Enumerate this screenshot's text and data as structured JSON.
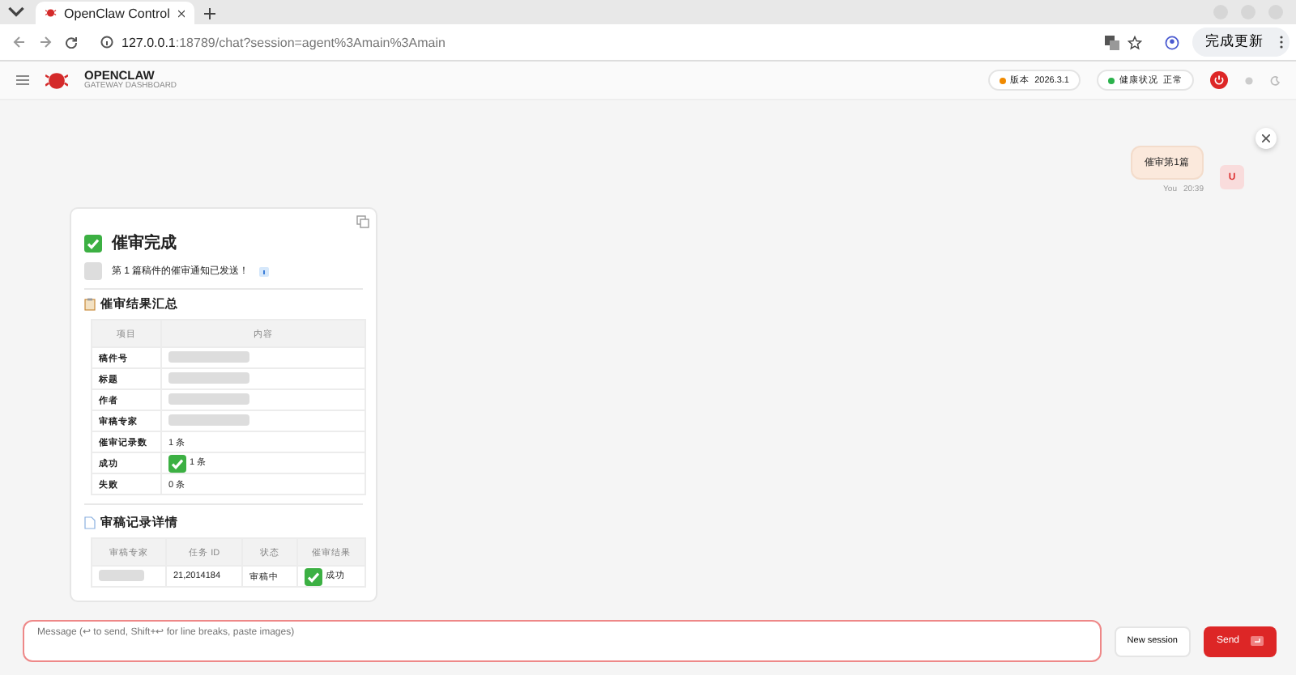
{
  "browser": {
    "tabs": [
      {
        "title": "OpenClaw Control",
        "selected": true
      }
    ],
    "url_host": "127.0.0.1",
    "url_rest": ":18789/chat?session=agent%3Amain%3Amain",
    "update_button": "完成更新"
  },
  "header": {
    "brand": "OPENCLAW",
    "subtitle": "GATEWAY DASHBOARD",
    "version_label": "版本",
    "version": "2026.3.1",
    "health_label": "健康状况",
    "health": "正常"
  },
  "user_message": {
    "text": "催审第1篇",
    "avatar": "U",
    "sender": "You",
    "time": "20:39"
  },
  "reply": {
    "title": "催审完成",
    "notice": "第 1 篇稿件的催审通知已发送！",
    "summary_title": "催审结果汇总",
    "summary_columns": [
      "项目",
      "内容"
    ],
    "summary_rows": [
      {
        "label": "稿件号",
        "value": "",
        "redacted": true
      },
      {
        "label": "标题",
        "value": "",
        "redacted": true
      },
      {
        "label": "作者",
        "value": "",
        "redacted": true
      },
      {
        "label": "审稿专家",
        "value": "",
        "redacted": true
      },
      {
        "label": "催审记录数",
        "value": "1 条",
        "redacted": false,
        "ok": false
      },
      {
        "label": "成功",
        "value": "1 条",
        "redacted": false,
        "ok": true
      },
      {
        "label": "失败",
        "value": "0 条",
        "redacted": false,
        "ok": false
      }
    ],
    "detail_title": "审稿记录详情",
    "detail_columns": [
      "审稿专家",
      "任务 ID",
      "状态",
      "催审结果"
    ],
    "detail_rows": [
      {
        "task_id": "21,2014184",
        "status": "审稿中",
        "result": "成功"
      }
    ]
  },
  "composer": {
    "placeholder": "Message (↩ to send, Shift+↩ for line breaks, paste images)",
    "new_session": "New session",
    "send": "Send"
  }
}
